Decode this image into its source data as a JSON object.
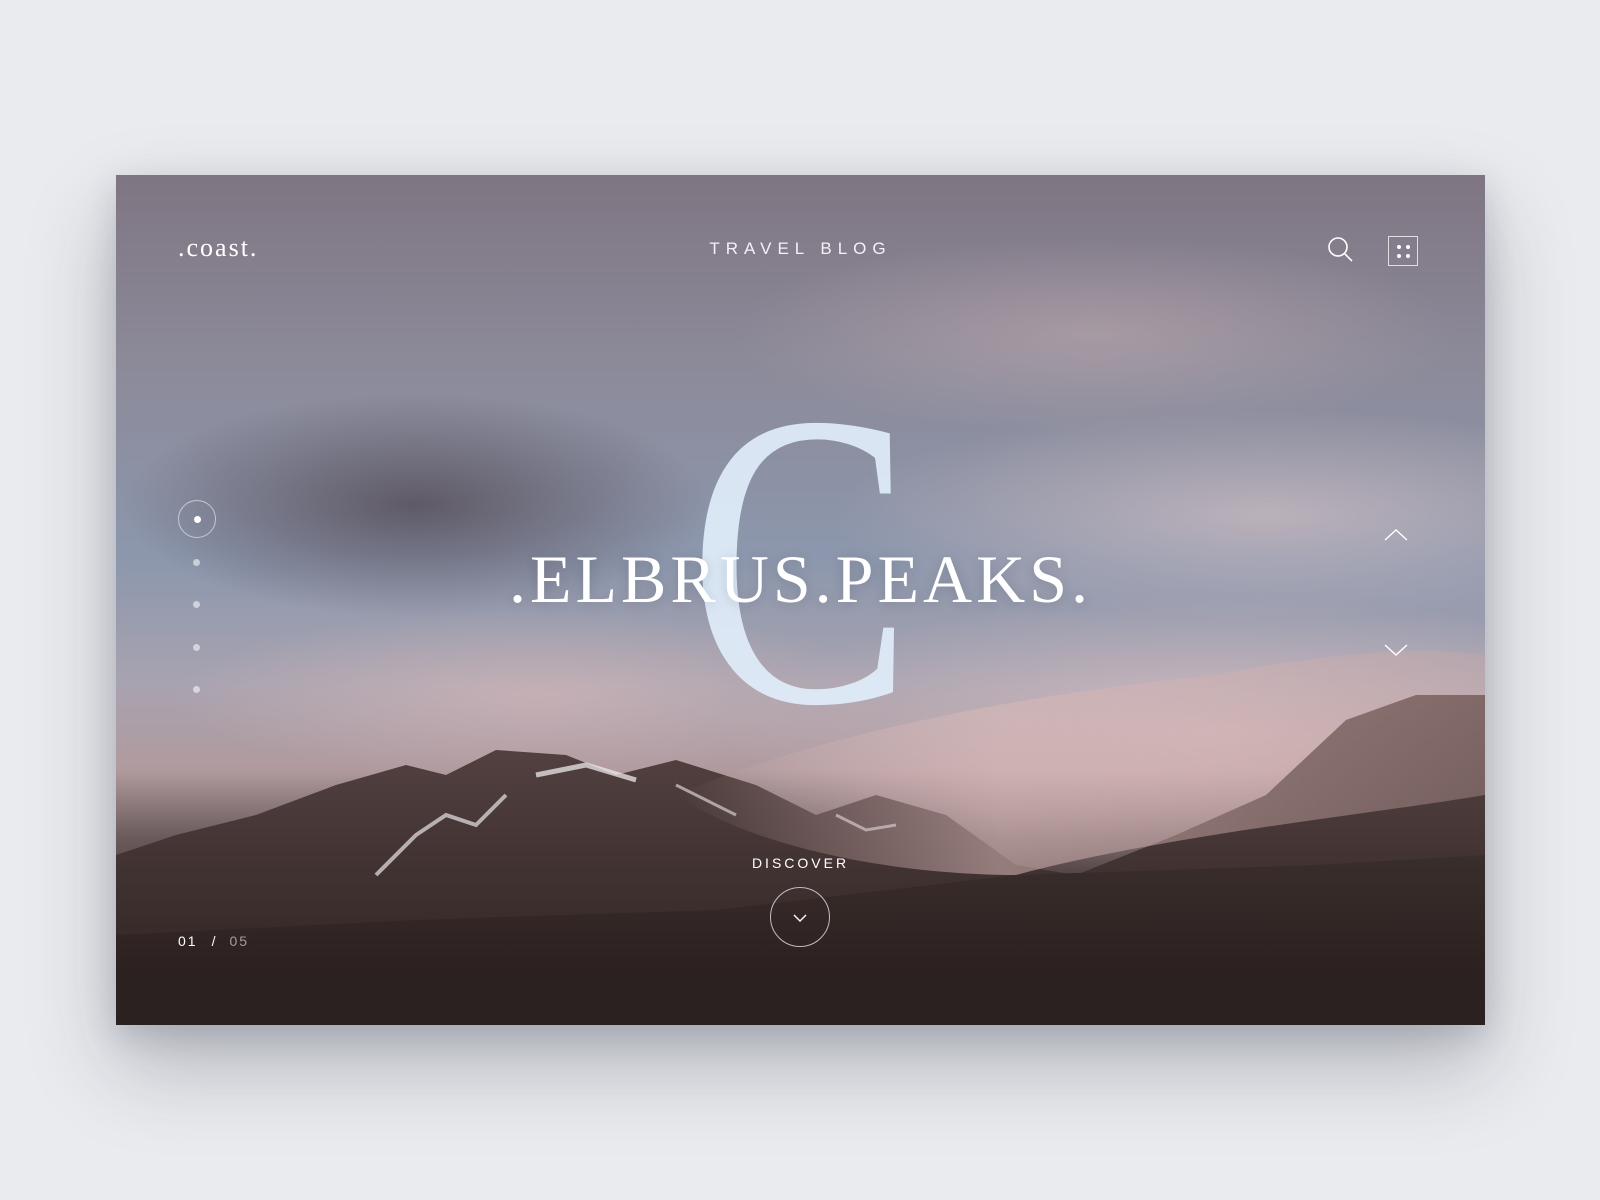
{
  "header": {
    "logo": ".coast.",
    "title": "TRAVEL BLOG",
    "search_icon": "search-icon",
    "menu_icon": "grid-menu-icon"
  },
  "hero": {
    "initial": "C",
    "headline": ".ELBRUS.PEAKS.",
    "discover_label": "DISCOVER",
    "discover_icon": "chevron-down-icon"
  },
  "pager": {
    "current": "01",
    "separator": "/",
    "total": "05",
    "slides": 5,
    "active_index": 0
  },
  "side_nav": {
    "up_icon": "chevron-up-icon",
    "down_icon": "chevron-down-icon"
  }
}
